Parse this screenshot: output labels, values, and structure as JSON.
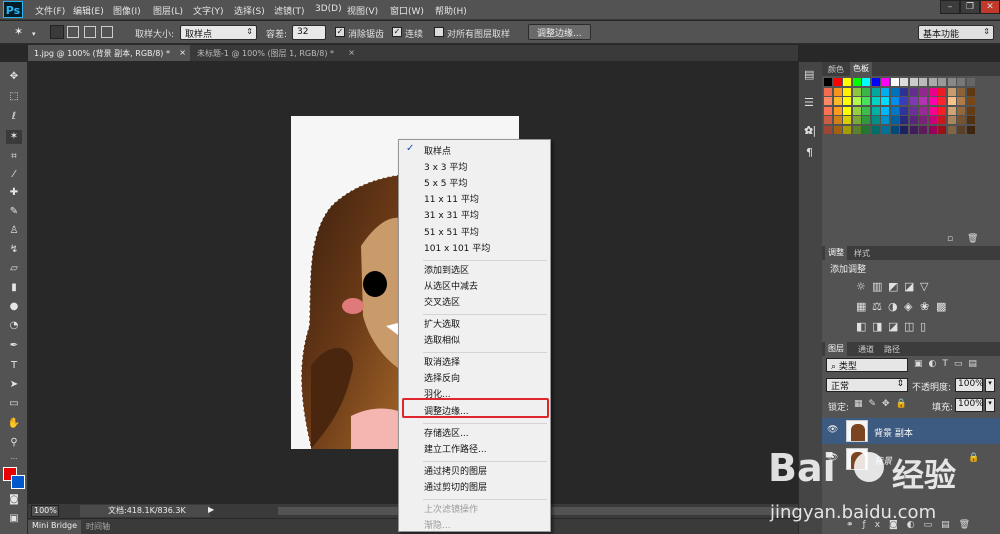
{
  "app": {
    "logo": "Ps"
  },
  "menubar": {
    "items": [
      "文件(F)",
      "编辑(E)",
      "图像(I)",
      "图层(L)",
      "文字(Y)",
      "选择(S)",
      "滤镜(T)",
      "3D(D)",
      "视图(V)",
      "窗口(W)",
      "帮助(H)"
    ]
  },
  "window_controls": {
    "minimize": "–",
    "restore": "❐",
    "close": "✕"
  },
  "options": {
    "sample_size_label": "取样大小:",
    "sample_size_value": "取样点",
    "tolerance_label": "容差:",
    "tolerance_value": "32",
    "antialias_label": "消除锯齿",
    "contiguous_label": "连续",
    "sample_all_label": "对所有图层取样",
    "refine_edge_button": "调整边缘...",
    "workspace": "基本功能"
  },
  "tabs": [
    {
      "label": "1.jpg @ 100% (背景 副本, RGB/8) *",
      "close": "×"
    },
    {
      "label": "未标题-1 @ 100% (图层 1, RGB/8) *",
      "close": "×"
    }
  ],
  "status": {
    "zoom": "100%",
    "doc_info": "文档:418.1K/836.3K"
  },
  "bottom_tabs": [
    "Mini Bridge",
    "时间轴"
  ],
  "panels": {
    "color_tabs": [
      "颜色",
      "色板"
    ],
    "adjust_tabs": [
      "调整",
      "样式"
    ],
    "adjust_title": "添加调整",
    "layers_tabs": [
      "图层",
      "通道",
      "路径"
    ],
    "kind_label": "类型",
    "blend_mode": "正常",
    "opacity_label": "不透明度:",
    "opacity_value": "100%",
    "lock_label": "锁定:",
    "fill_label": "填充:",
    "fill_value": "100%",
    "layers": [
      {
        "name": "背景 副本"
      },
      {
        "name": "背景"
      }
    ]
  },
  "context_menu": {
    "groups": [
      [
        {
          "label": "取样点",
          "checked": true
        },
        {
          "label": "3 x 3 平均"
        },
        {
          "label": "5 x 5 平均"
        },
        {
          "label": "11 x 11 平均"
        },
        {
          "label": "31 x 31 平均"
        },
        {
          "label": "51 x 51 平均"
        },
        {
          "label": "101 x 101 平均"
        }
      ],
      [
        {
          "label": "添加到选区"
        },
        {
          "label": "从选区中减去"
        },
        {
          "label": "交叉选区"
        }
      ],
      [
        {
          "label": "扩大选取"
        },
        {
          "label": "选取相似"
        }
      ],
      [
        {
          "label": "取消选择"
        },
        {
          "label": "选择反向"
        },
        {
          "label": "羽化..."
        },
        {
          "label": "调整边缘..."
        }
      ],
      [
        {
          "label": "存储选区..."
        },
        {
          "label": "建立工作路径..."
        }
      ],
      [
        {
          "label": "通过拷贝的图层"
        },
        {
          "label": "通过剪切的图层"
        }
      ],
      [
        {
          "label": "上次滤镜操作",
          "disabled": true
        },
        {
          "label": "渐隐...",
          "disabled": true
        }
      ]
    ],
    "check_mark": "✓"
  },
  "watermark": {
    "brand": "Bai",
    "brand2": "经验",
    "url": "jingyan.baidu.com"
  },
  "colors": {
    "accent_red": "#e0262b",
    "fg": "#e60000",
    "bg": "#0058cc"
  }
}
